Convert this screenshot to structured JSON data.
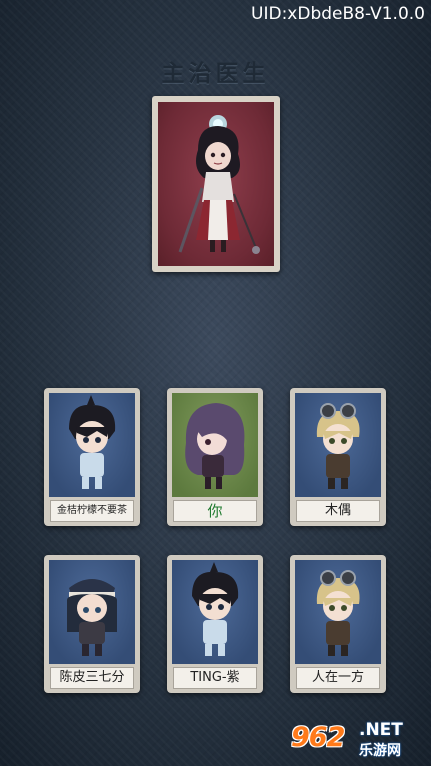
{
  "uid_text": "UID:xDbdeB8-V1.0.0",
  "role_title": "主治医生",
  "featured_character": {
    "icon": "doctor-character-portrait"
  },
  "players": [
    {
      "name": "金桔柠檬不要茶",
      "is_self": false,
      "icon": "chibi-dark-hair-portrait"
    },
    {
      "name": "你",
      "is_self": true,
      "icon": "chibi-purple-hair-portrait"
    },
    {
      "name": "木偶",
      "is_self": false,
      "icon": "chibi-goggles-portrait"
    },
    {
      "name": "陈皮三七分",
      "is_self": false,
      "icon": "chibi-captain-hat-portrait"
    },
    {
      "name": "TING-紫",
      "is_self": false,
      "icon": "chibi-dark-hair-portrait"
    },
    {
      "name": "人在一方",
      "is_self": false,
      "icon": "chibi-goggles-portrait"
    }
  ],
  "watermark": {
    "number": "962",
    "domain": ".NET",
    "site_name": "乐游网"
  },
  "colors": {
    "self_name": "#1e7a2e",
    "card_art_blue": "#344d76",
    "card_art_green": "#5d7a3e",
    "featured_art_red": "#6e2a36"
  }
}
